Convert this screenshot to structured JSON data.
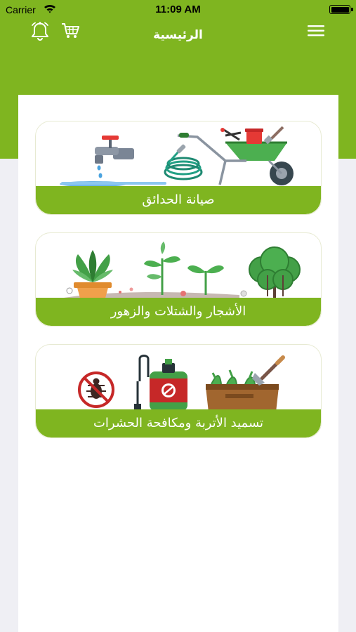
{
  "status_bar": {
    "carrier": "Carrier",
    "time": "11:09 AM"
  },
  "nav": {
    "title": "الرئيسية",
    "icons": [
      "bell-icon",
      "cart-icon",
      "menu-icon"
    ]
  },
  "colors": {
    "brand_green": "#7fb520",
    "page_bg": "#efeff4",
    "card_bg": "#ffffff"
  },
  "categories": [
    {
      "label": "صيانة الحدائق",
      "illustration": "garden-maintenance-illustration"
    },
    {
      "label": "الأشجار والشتلات والزهور",
      "illustration": "trees-seedlings-flowers-illustration"
    },
    {
      "label": "تسميد الأتربة ومكافحة الحشرات",
      "illustration": "soil-fertilizer-pest-control-illustration"
    }
  ]
}
